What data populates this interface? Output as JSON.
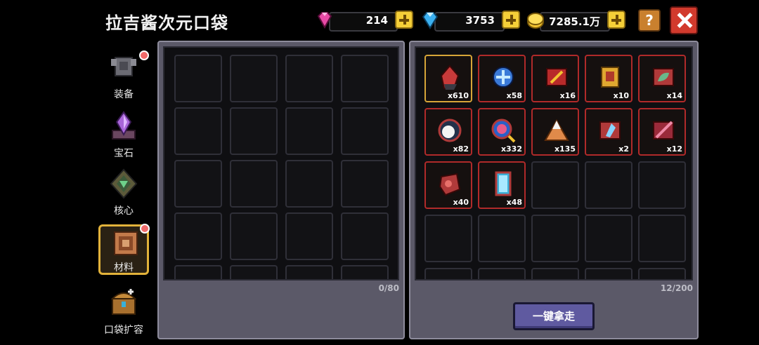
{
  "title": "拉吉酱次元口袋",
  "currencies": [
    {
      "name": "pink-gem",
      "value": "214"
    },
    {
      "name": "blue-gem",
      "value": "3753"
    },
    {
      "name": "gold-coin",
      "value": "7285.1万"
    }
  ],
  "help_label": "?",
  "sidebar": {
    "items": [
      {
        "label": "装备",
        "badge": true,
        "active": false
      },
      {
        "label": "宝石",
        "badge": false,
        "active": false
      },
      {
        "label": "核心",
        "badge": false,
        "active": false
      },
      {
        "label": "材料",
        "badge": true,
        "active": true
      },
      {
        "label": "口袋扩容",
        "badge": false,
        "active": false
      }
    ]
  },
  "left_panel": {
    "capacity": "0/80"
  },
  "right_panel": {
    "capacity": "12/200",
    "items": [
      {
        "icon": "red-crystal-icon",
        "count": "x610"
      },
      {
        "icon": "blue-orb-icon",
        "count": "x58"
      },
      {
        "icon": "sword-scroll-icon",
        "count": "x16"
      },
      {
        "icon": "gold-relic-icon",
        "count": "x10"
      },
      {
        "icon": "green-leaf-icon",
        "count": "x14"
      },
      {
        "icon": "white-pearl-icon",
        "count": "x82"
      },
      {
        "icon": "magic-lens-icon",
        "count": "x332"
      },
      {
        "icon": "sand-pile-icon",
        "count": "x135"
      },
      {
        "icon": "ice-shard-icon",
        "count": "x2"
      },
      {
        "icon": "pink-feather-icon",
        "count": "x12"
      },
      {
        "icon": "red-ore-icon",
        "count": "x40"
      },
      {
        "icon": "blue-card-icon",
        "count": "x48"
      }
    ],
    "collect_label": "一键拿走"
  },
  "colors": {
    "accent": "#5f5aa0",
    "item_border": "#b02a2a",
    "plus": "#f5cf38",
    "close": "#d23a2d"
  }
}
